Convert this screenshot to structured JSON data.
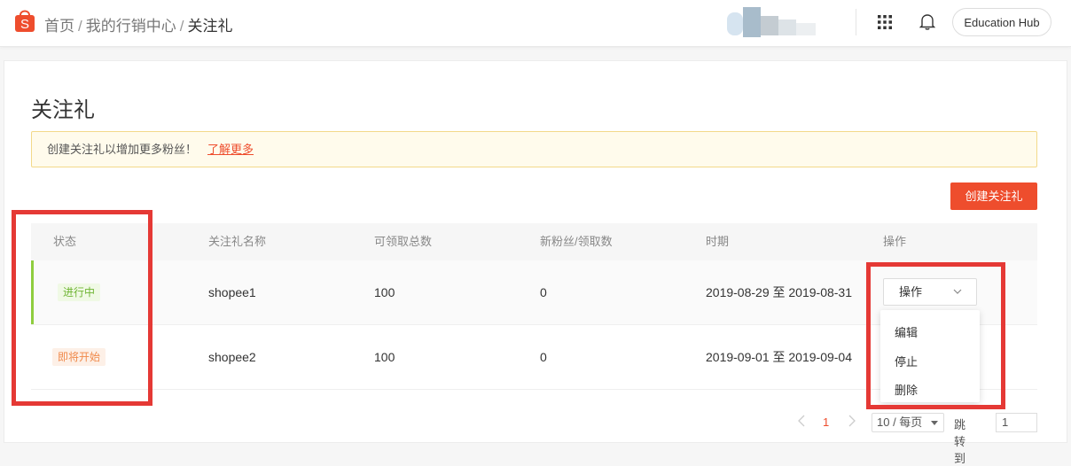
{
  "header": {
    "breadcrumb": [
      "首页",
      "我的行销中心",
      "关注礼"
    ],
    "separator": "/",
    "education_hub_label": "Education Hub"
  },
  "page": {
    "title": "关注礼",
    "notice_text": "创建关注礼以增加更多粉丝！",
    "notice_link": "了解更多",
    "create_button": "创建关注礼"
  },
  "table": {
    "columns": [
      "状态",
      "关注礼名称",
      "可领取总数",
      "新粉丝/领取数",
      "时期",
      "操作"
    ],
    "rows": [
      {
        "status": "进行中",
        "name": "shopee1",
        "total": "100",
        "new_fans": "0",
        "period": "2019-08-29 至 2019-08-31"
      },
      {
        "status": "即将开始",
        "name": "shopee2",
        "total": "100",
        "new_fans": "0",
        "period": "2019-09-01 至 2019-09-04"
      }
    ],
    "action_label": "操作",
    "action_menu": [
      "编辑",
      "停止",
      "删除"
    ]
  },
  "pagination": {
    "current_page": "1",
    "page_size": "10 / 每页",
    "jump_label": "跳转到",
    "jump_value": "1"
  },
  "colors": {
    "brand": "#ee4d2d",
    "ongoing": "#6fb534",
    "upcoming": "#f08a4b",
    "highlight": "#e53935"
  },
  "icons": [
    "shopee-logo-icon",
    "apps-grid-icon",
    "bell-icon",
    "chevron-down-icon",
    "chevron-left-icon",
    "chevron-right-icon",
    "caret-down-icon"
  ]
}
